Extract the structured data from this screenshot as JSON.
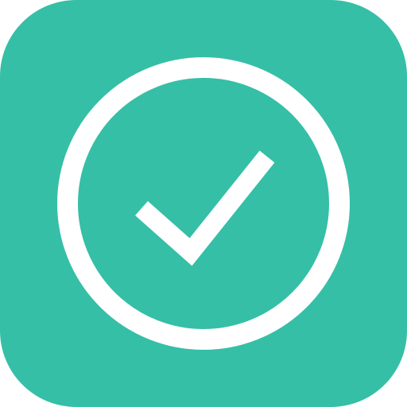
{
  "icon": {
    "name": "check-circle-icon",
    "background_color": "#35BFA6",
    "foreground_color": "#FFFFFF",
    "shape": "rounded-square",
    "glyph": "checkmark-in-circle"
  }
}
